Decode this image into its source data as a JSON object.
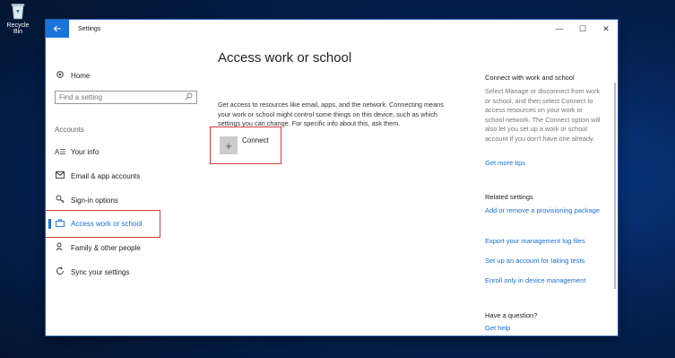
{
  "desktop": {
    "recycle_bin_label": "Recycle Bin"
  },
  "window": {
    "title": "Settings",
    "back_icon": "back-arrow-icon",
    "minimize": "—",
    "maximize": "☐",
    "close": "✕"
  },
  "sidebar": {
    "home_label": "Home",
    "search_placeholder": "Find a setting",
    "section_label": "Accounts",
    "items": [
      {
        "label": "Your info",
        "icon": "person-card-icon"
      },
      {
        "label": "Email & app accounts",
        "icon": "mail-icon"
      },
      {
        "label": "Sign-in options",
        "icon": "key-icon"
      },
      {
        "label": "Access work or school",
        "icon": "briefcase-icon",
        "active": true
      },
      {
        "label": "Family & other people",
        "icon": "people-icon"
      },
      {
        "label": "Sync your settings",
        "icon": "sync-icon"
      }
    ]
  },
  "main": {
    "title": "Access work or school",
    "description": "Get access to resources like email, apps, and the network. Connecting means your work or school might control some things on this device, such as which settings you can change. For specific info about this, ask them.",
    "connect_label": "Connect"
  },
  "rail": {
    "connect_heading": "Connect with work and school",
    "connect_text": "Select Manage or disconnect from work or school, and then select Connect to access resources on your work or school network. The Connect option will also let you set up a work or school account if you don't have one already.",
    "get_more_tips": "Get more tips",
    "related_heading": "Related settings",
    "related_links": [
      "Add or remove a provisioning package",
      "Export your management log files",
      "Set up an account for taking tests",
      "Enroll only in device management"
    ],
    "question_heading": "Have a question?",
    "get_help": "Get help"
  },
  "colors": {
    "accent": "#1a73d9",
    "highlight": "#d63b3b",
    "link": "#1a6fd0"
  }
}
